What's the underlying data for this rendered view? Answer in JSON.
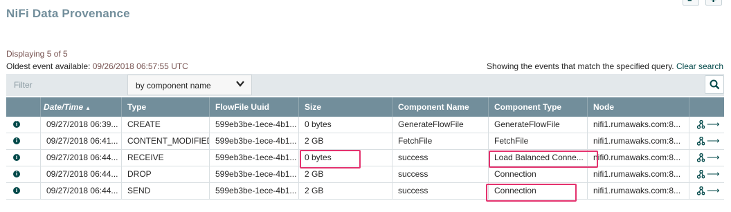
{
  "page": {
    "title": "NiFi Data Provenance",
    "summary": "Displaying 5 of 5",
    "oldest_label": "Oldest event available: ",
    "oldest_value": "09/26/2018 06:57:55 UTC",
    "matching_text": "Showing the events that match the specified query. ",
    "clear_search": "Clear search"
  },
  "filter": {
    "placeholder": "Filter",
    "type_selected": "by component name"
  },
  "table": {
    "columns": [
      "Date/Time",
      "Type",
      "FlowFile Uuid",
      "Size",
      "Component Name",
      "Component Type",
      "Node"
    ],
    "sorted_column": "Date/Time",
    "sort_direction": "ascending",
    "rows": [
      {
        "datetime": "09/27/2018 06:39...",
        "type": "CREATE",
        "uuid": "599eb3be-1ece-4b1...",
        "size": "0 bytes",
        "component_name": "GenerateFlowFile",
        "component_type": "GenerateFlowFile",
        "node": "nifi1.rumawaks.com:8..."
      },
      {
        "datetime": "09/27/2018 06:41...",
        "type": "CONTENT_MODIFIED",
        "uuid": "599eb3be-1ece-4b1...",
        "size": "2 GB",
        "component_name": "FetchFile",
        "component_type": "FetchFile",
        "node": "nifi1.rumawaks.com:8..."
      },
      {
        "datetime": "09/27/2018 06:44...",
        "type": "RECEIVE",
        "uuid": "599eb3be-1ece-4b1...",
        "size": "0 bytes",
        "component_name": "success",
        "component_type": "Load Balanced Conne...",
        "node": "nifi0.rumawaks.com:8..."
      },
      {
        "datetime": "09/27/2018 06:44...",
        "type": "DROP",
        "uuid": "599eb3be-1ece-4b1...",
        "size": "2 GB",
        "component_name": "success",
        "component_type": "Connection",
        "node": "nifi1.rumawaks.com:8..."
      },
      {
        "datetime": "09/27/2018 06:44...",
        "type": "SEND",
        "uuid": "599eb3be-1ece-4b1...",
        "size": "2 GB",
        "component_name": "success",
        "component_type": "Connection",
        "node": "nifi1.rumawaks.com:8..."
      }
    ]
  },
  "icons": {
    "info": "info-icon",
    "lineage": "lineage-icon",
    "goto": "go-to-arrow-icon",
    "search": "search-icon",
    "chevron": "chevron-down-icon"
  },
  "colors": {
    "title": "#728e9b",
    "header_bg": "#728e9b",
    "accent": "#004849",
    "annotation": "#e4326e",
    "summary": "#775351"
  }
}
